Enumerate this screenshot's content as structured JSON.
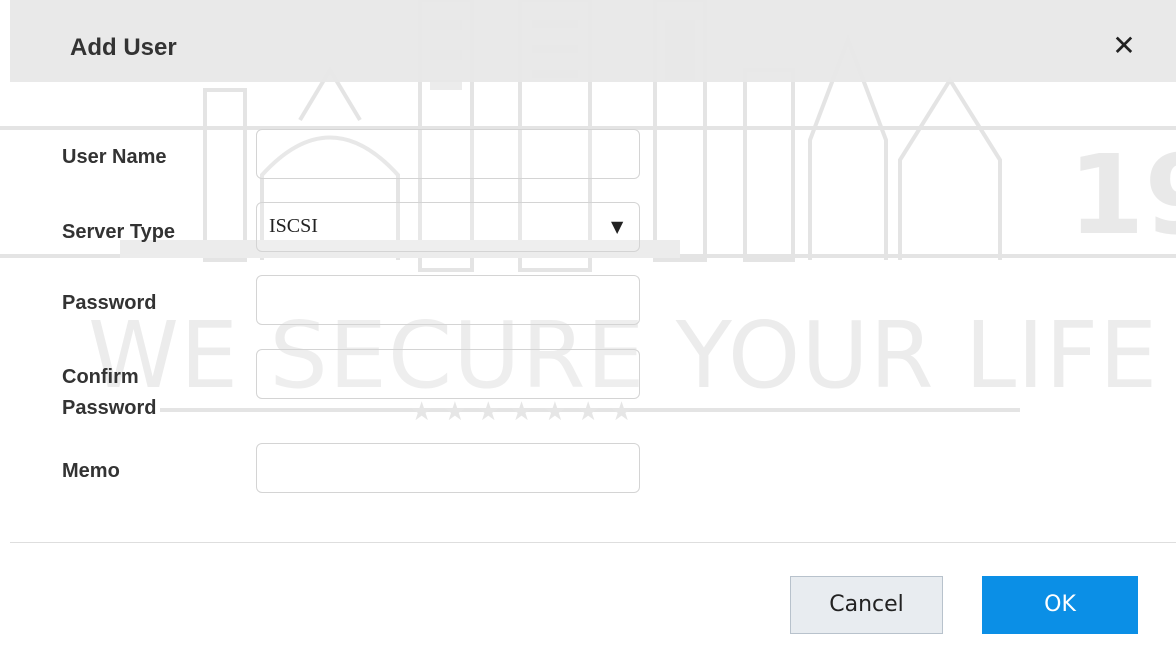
{
  "watermark": {
    "slogan": "WE SECURE YOUR LIFE",
    "year_fragment": "19",
    "stars": "★★★★★★★"
  },
  "dialog": {
    "title": "Add User",
    "close_icon": "close-icon",
    "fields": {
      "user_name": {
        "label": "User Name",
        "value": ""
      },
      "server_type": {
        "label": "Server Type",
        "value": "ISCSI",
        "arrow_icon": "triangle-down-icon"
      },
      "password": {
        "label": "Password",
        "value": ""
      },
      "confirm_password": {
        "label_line1": "Confirm",
        "label_line2": "Password",
        "value": ""
      },
      "memo": {
        "label": "Memo",
        "value": ""
      }
    },
    "buttons": {
      "cancel": "Cancel",
      "ok": "OK"
    }
  },
  "colors": {
    "header_bg": "#e8e8e8",
    "primary": "#0b8fe6",
    "cancel_bg": "#e8ecf0",
    "text": "#333333"
  }
}
